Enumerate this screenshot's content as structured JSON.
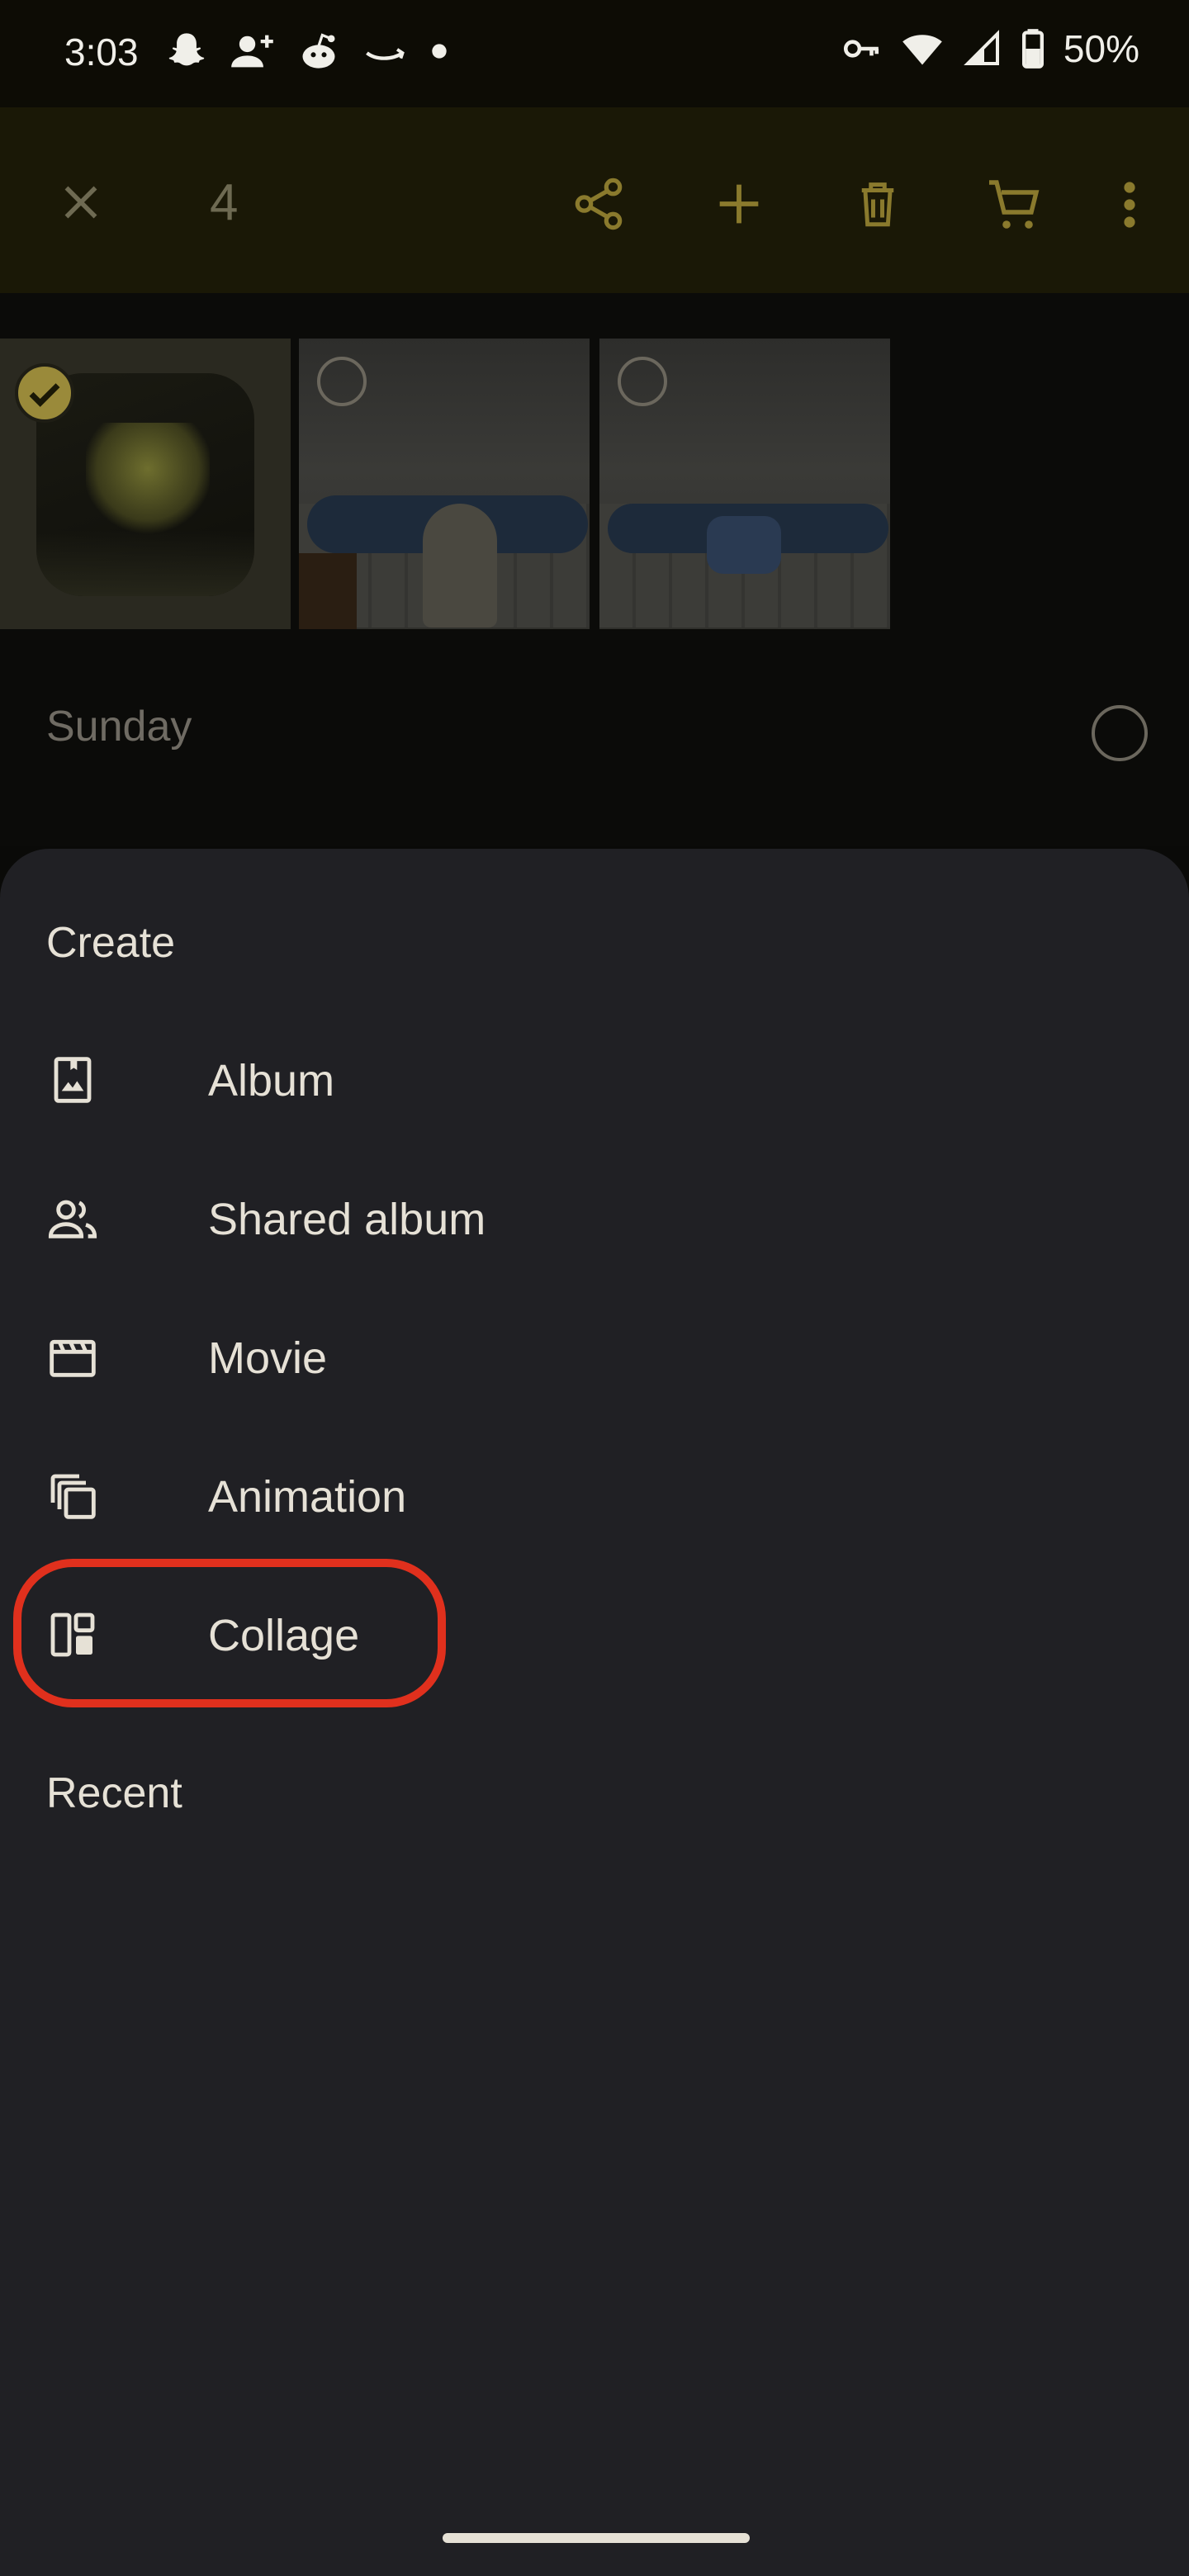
{
  "status": {
    "time": "3:03",
    "battery": "50%"
  },
  "toolbar": {
    "count": "4",
    "actions": [
      "close-icon",
      "share-icon",
      "add-icon",
      "delete-icon",
      "shopping-cart-icon",
      "more-icon"
    ]
  },
  "grid": {
    "day_label": "Sunday"
  },
  "sheet": {
    "create_header": "Create",
    "items": [
      {
        "label": "Album",
        "icon": "album-icon"
      },
      {
        "label": "Shared album",
        "icon": "shared-album-icon"
      },
      {
        "label": "Movie",
        "icon": "movie-icon"
      },
      {
        "label": "Animation",
        "icon": "animation-icon"
      },
      {
        "label": "Collage",
        "icon": "collage-icon"
      }
    ],
    "recent_header": "Recent"
  },
  "colors": {
    "accent": "#8a7a2d",
    "sheet_bg": "#202024",
    "highlight": "#e0301d"
  }
}
